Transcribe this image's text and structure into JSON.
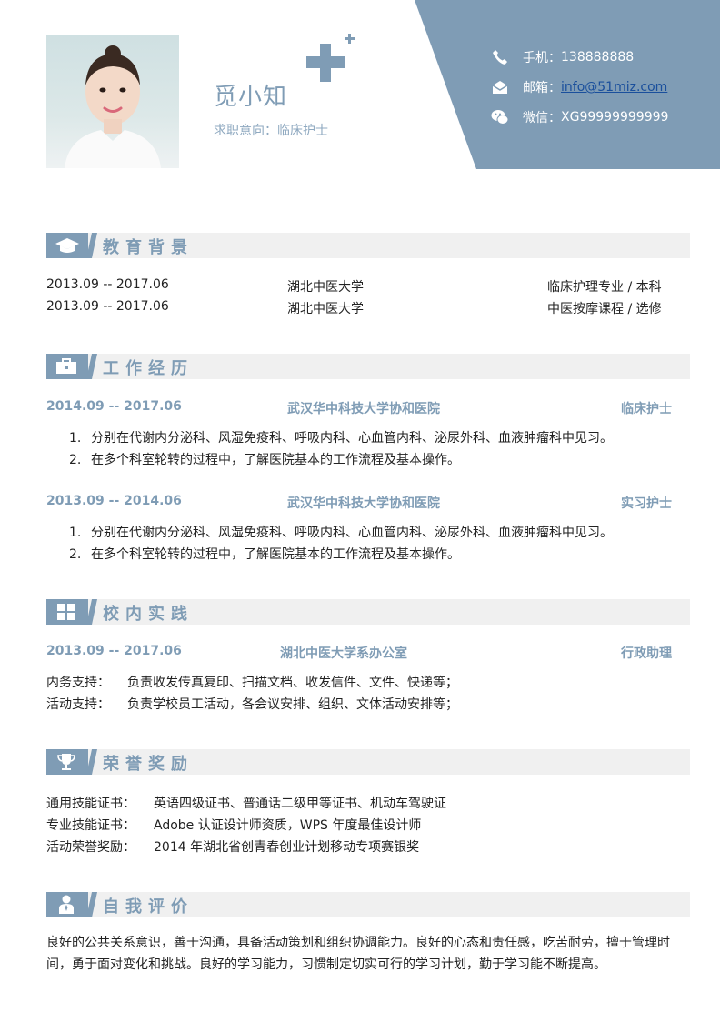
{
  "header": {
    "name": "觅小知",
    "intent": "求职意向：临床护士",
    "contacts": [
      {
        "icon": "phone-icon",
        "label": "手机：",
        "value": "138888888"
      },
      {
        "icon": "mail-icon",
        "label": "邮箱：",
        "value": "info@51miz.com"
      },
      {
        "icon": "wechat-icon",
        "label": "微信：",
        "value": "XG99999999999"
      }
    ],
    "accent": "#7f9cb5"
  },
  "education": {
    "title": "教育背景",
    "rows": [
      {
        "date": "2013.09 -- 2017.06",
        "school": "湖北中医大学",
        "major": "临床护理专业 / 本科"
      },
      {
        "date": "2013.09 -- 2017.06",
        "school": "湖北中医大学",
        "major": "中医按摩课程 / 选修"
      }
    ]
  },
  "work": {
    "title": "工作经历",
    "jobs": [
      {
        "date": "2014.09 -- 2017.06",
        "org": "武汉华中科技大学协和医院",
        "role": "临床护士",
        "items": [
          "分别在代谢内分泌科、风湿免疫科、呼吸内科、心血管内科、泌尿外科、血液肿瘤科中见习。",
          "在多个科室轮转的过程中，了解医院基本的工作流程及基本操作。"
        ]
      },
      {
        "date": "2013.09 -- 2014.06",
        "org": "武汉华中科技大学协和医院",
        "role": "实习护士",
        "items": [
          "分别在代谢内分泌科、风湿免疫科、呼吸内科、心血管内科、泌尿外科、血液肿瘤科中见习。",
          "在多个科室轮转的过程中，了解医院基本的工作流程及基本操作。"
        ]
      }
    ]
  },
  "campus": {
    "title": "校内实践",
    "date": "2013.09 -- 2017.06",
    "org": "湖北中医大学系办公室",
    "role": "行政助理",
    "rows": [
      {
        "label": "内务支持：",
        "text": "负责收发传真复印、扫描文档、收发信件、文件、快递等；"
      },
      {
        "label": "活动支持：",
        "text": "负责学校员工活动，各会议安排、组织、文体活动安排等；"
      }
    ]
  },
  "honors": {
    "title": "荣誉奖励",
    "rows": [
      {
        "label": "通用技能证书：",
        "text": "英语四级证书、普通话二级甲等证书、机动车驾驶证"
      },
      {
        "label": "专业技能证书：",
        "text": "Adobe 认证设计师资质，WPS 年度最佳设计师"
      },
      {
        "label": "活动荣誉奖励：",
        "text": "2014 年湖北省创青春创业计划移动专项赛银奖"
      }
    ]
  },
  "self": {
    "title": "自我评价",
    "text": "良好的公共关系意识，善于沟通，具备活动策划和组织协调能力。良好的心态和责任感，吃苦耐劳，擅于管理时间，勇于面对变化和挑战。良好的学习能力，习惯制定切实可行的学习计划，勤于学习能不断提高。"
  }
}
